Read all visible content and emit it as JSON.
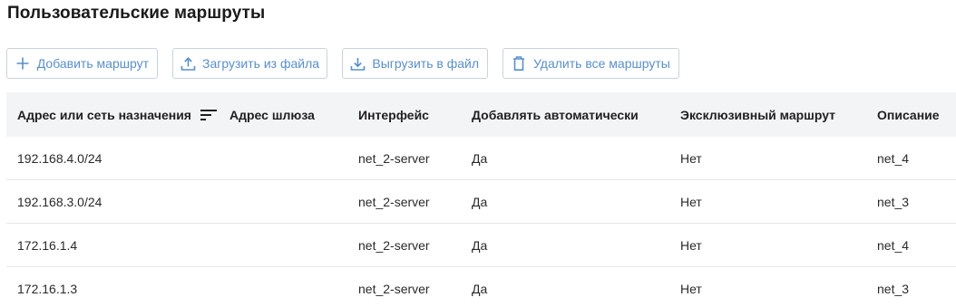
{
  "page": {
    "title": "Пользовательские маршруты"
  },
  "toolbar": {
    "add_label": "Добавить маршрут",
    "upload_label": "Загрузить из файла",
    "download_label": "Выгрузить в файл",
    "delete_all_label": "Удалить все маршруты",
    "accent_color": "#5a8fc8",
    "icons": {
      "add": "plus-icon",
      "upload": "upload-icon",
      "download": "download-icon",
      "delete_all": "trash-icon"
    }
  },
  "table": {
    "columns": [
      "Адрес или сеть назначения",
      "Адрес шлюза",
      "Интерфейс",
      "Добавлять автоматически",
      "Эксклюзивный маршрут",
      "Описание"
    ],
    "sort_icon": "sort-icon",
    "rows": [
      {
        "destination": "192.168.4.0/24",
        "gateway": "",
        "interface": "net_2-server",
        "auto_add": "Да",
        "exclusive": "Нет",
        "description": "net_4"
      },
      {
        "destination": "192.168.3.0/24",
        "gateway": "",
        "interface": "net_2-server",
        "auto_add": "Да",
        "exclusive": "Нет",
        "description": "net_3"
      },
      {
        "destination": "172.16.1.4",
        "gateway": "",
        "interface": "net_2-server",
        "auto_add": "Да",
        "exclusive": "Нет",
        "description": "net_4"
      },
      {
        "destination": "172.16.1.3",
        "gateway": "",
        "interface": "net_2-server",
        "auto_add": "Да",
        "exclusive": "Нет",
        "description": "net_3"
      }
    ]
  }
}
